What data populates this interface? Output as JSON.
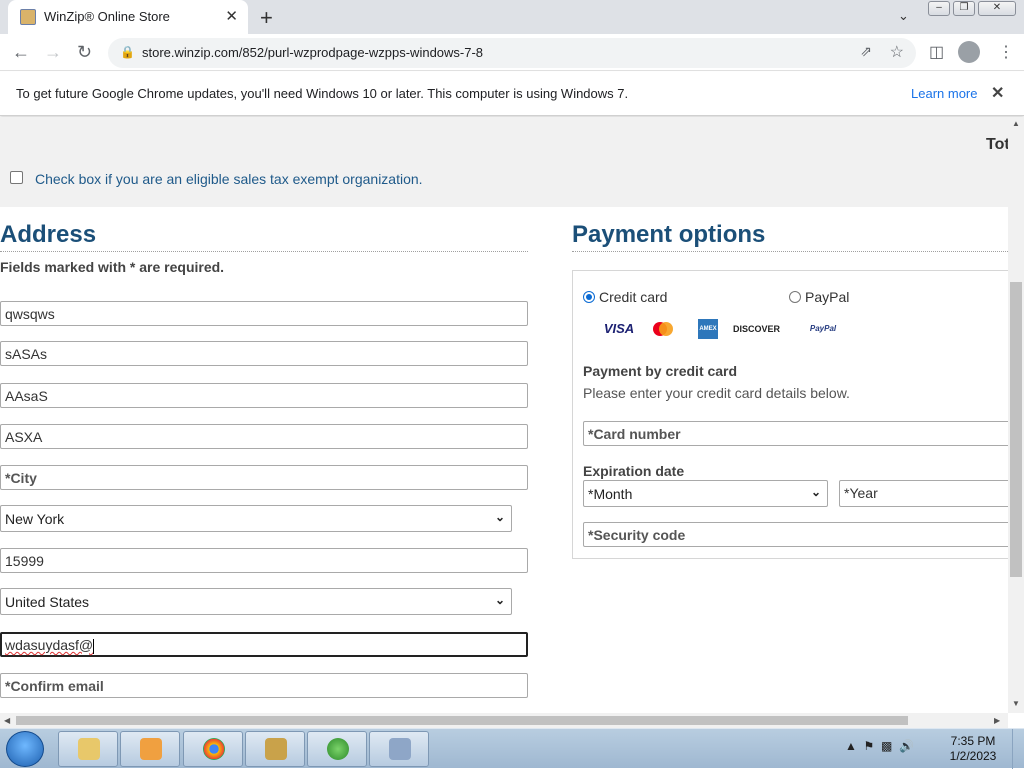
{
  "browser": {
    "tab_title": "WinZip® Online Store",
    "tab_close": "✕",
    "new_tab": "+",
    "url": "store.winzip.com/852/purl-wzprodpage-wzpps-windows-7-8"
  },
  "infobar": {
    "message": "To get future Google Chrome updates, you'll need Windows 10 or later. This computer is using Windows 7.",
    "learn_more": "Learn more",
    "close": "✕"
  },
  "page": {
    "total_label": "Tot",
    "tax_exempt_label": "Check box if you are an eligible sales tax exempt organization.",
    "address": {
      "heading": "Address",
      "required_note": "Fields marked with * are required.",
      "first_name_value": "qwsqws",
      "last_name_value": "sASAs",
      "address1_value": "AAsaS",
      "address2_value": "ASXA",
      "city_placeholder": "*City",
      "state_value": "New York",
      "zip_value": "15999",
      "country_value": "United States",
      "email_value": "wdasuydasf@",
      "confirm_email_placeholder": "*Confirm email"
    },
    "payment": {
      "heading": "Payment options",
      "credit_card_label": "Credit card",
      "paypal_label": "PayPal",
      "credit_card_selected": true,
      "card_brands": [
        "VISA",
        "MC",
        "AMEX",
        "DISCOVER",
        "PayPal"
      ],
      "by_card_title": "Payment by credit card",
      "by_card_subtitle": "Please enter your credit card details below.",
      "card_number_placeholder": "*Card number",
      "expiration_label": "Expiration date",
      "month_value": "*Month",
      "year_placeholder": "*Year",
      "security_code_placeholder": "*Security code"
    }
  },
  "taskbar": {
    "time": "7:35 PM",
    "date": "1/2/2023"
  },
  "colors": {
    "heading": "#1b4f78",
    "link": "#1a73e8",
    "radio_selected": "#0b6bd4"
  }
}
